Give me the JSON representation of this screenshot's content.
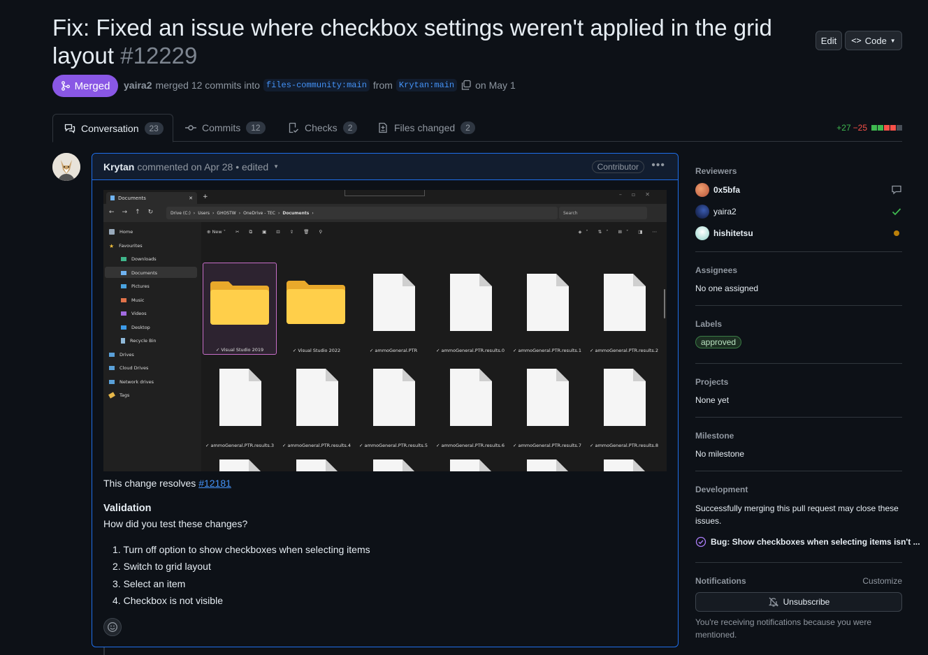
{
  "pr": {
    "title": "Fix: Fixed an issue where checkbox settings weren't applied in the grid layout",
    "number": "#12229",
    "edit_label": "Edit",
    "code_label": "Code",
    "state": "Merged",
    "author": "yaira2",
    "merged_text": "merged 12 commits into",
    "base_branch": "files-community:main",
    "from_text": "from",
    "head_branch": "Krytan:main",
    "date_text": "on May 1"
  },
  "tabs": [
    {
      "label": "Conversation",
      "count": "23"
    },
    {
      "label": "Commits",
      "count": "12"
    },
    {
      "label": "Checks",
      "count": "2"
    },
    {
      "label": "Files changed",
      "count": "2"
    }
  ],
  "diffstat": {
    "additions": "+27",
    "deletions": "−25"
  },
  "comment": {
    "author": "Krytan",
    "action": "commented on Apr 28",
    "edited": "• edited",
    "role": "Contributor",
    "resolves_text": "This change resolves",
    "issue_link": "#12181",
    "validation_heading": "Validation",
    "validation_question": "How did you test these changes?",
    "steps": [
      "Turn off option to show checkboxes when selecting items",
      "Switch to grid layout",
      "Select an item",
      "Checkbox is not visible"
    ]
  },
  "screenshot": {
    "tab_title": "Documents",
    "path": [
      "Drive (C:)",
      "Users",
      "GHOSTW",
      "OneDrive - TEC",
      "Documents"
    ],
    "search_placeholder": "Search",
    "new_label": "New",
    "sidebar": [
      "Home",
      "Favourites",
      "Downloads",
      "Documents",
      "Pictures",
      "Music",
      "Videos",
      "Desktop",
      "Recycle Bin",
      "Drives",
      "Cloud Drives",
      "Network drives",
      "Tags"
    ],
    "items": [
      "Visual Studio 2019",
      "Visual Studio 2022",
      "ammoGeneral.PTR",
      "ammoGeneral.PTR.results.0",
      "ammoGeneral.PTR.results.1",
      "ammoGeneral.PTR.results.2",
      "ammoGeneral.PTR.results.3",
      "ammoGeneral.PTR.results.4",
      "ammoGeneral.PTR.results.5",
      "ammoGeneral.PTR.results.6",
      "ammoGeneral.PTR.results.7",
      "ammoGeneral.PTR.results.8"
    ]
  },
  "sidebar": {
    "reviewers_heading": "Reviewers",
    "reviewers": [
      "0x5bfa",
      "yaira2",
      "hishitetsu"
    ],
    "assignees_heading": "Assignees",
    "assignees_value": "No one assigned",
    "labels_heading": "Labels",
    "label": "approved",
    "projects_heading": "Projects",
    "projects_value": "None yet",
    "milestone_heading": "Milestone",
    "milestone_value": "No milestone",
    "development_heading": "Development",
    "development_text": "Successfully merging this pull request may close these issues.",
    "linked_issue": "Bug: Show checkboxes when selecting items isn't ...",
    "notifications_heading": "Notifications",
    "customize_label": "Customize",
    "unsubscribe_label": "Unsubscribe",
    "notification_reason": "You're receiving notifications because you were mentioned."
  },
  "colors": {
    "merged": "#8957e5",
    "accent": "#4493f8",
    "addition": "#3fb950",
    "deletion": "#f85149"
  }
}
